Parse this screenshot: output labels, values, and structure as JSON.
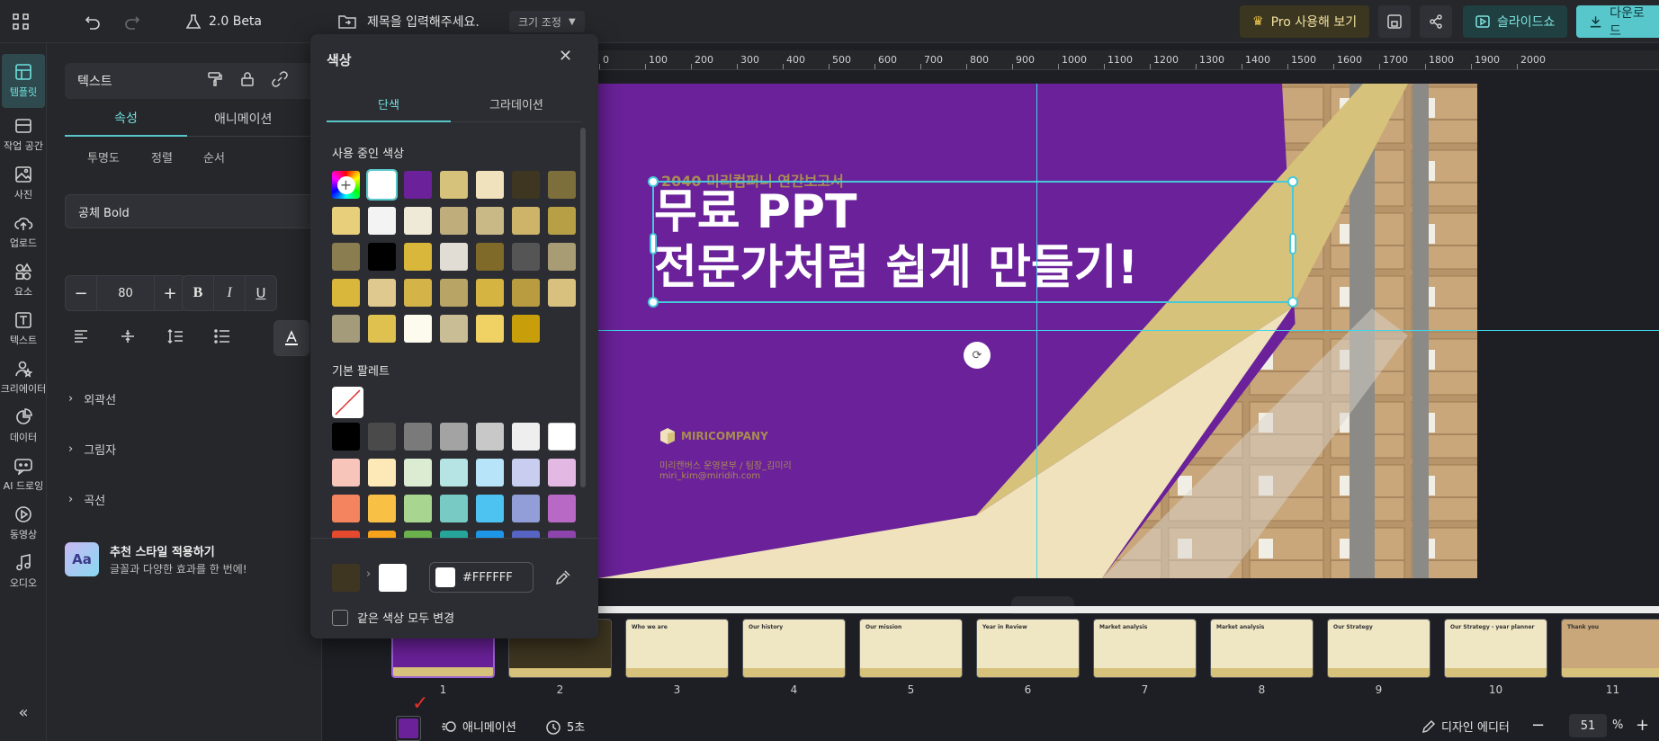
{
  "topbar": {
    "version": "2.0 Beta",
    "title_placeholder": "제목을 입력해주세요.",
    "resize_label": "크기 조정",
    "pro_label": "Pro 사용해 보기",
    "slideshow_label": "슬라이드쇼",
    "download_label": "다운로드"
  },
  "leftnav": [
    {
      "label": "템플릿"
    },
    {
      "label": "작업 공간"
    },
    {
      "label": "사진"
    },
    {
      "label": "업로드"
    },
    {
      "label": "요소"
    },
    {
      "label": "텍스트"
    },
    {
      "label": "크리에이터"
    },
    {
      "label": "데이터"
    },
    {
      "label": "AI 드로잉"
    },
    {
      "label": "동영상"
    },
    {
      "label": "오디오"
    }
  ],
  "panel": {
    "header": "텍스트",
    "tabs": [
      "속성",
      "애니메이션"
    ],
    "subtabs": [
      "투명도",
      "정렬",
      "순서"
    ],
    "font": "공체 Bold",
    "font_size": "80",
    "sections": [
      "외곽선",
      "그림자",
      "곡선"
    ],
    "promo_title": "추천 스타일 적용하기",
    "promo_desc": "글꼴과 다양한 효과를 한 번에!"
  },
  "colorpicker": {
    "title": "색상",
    "tabs": [
      "단색",
      "그라데이션"
    ],
    "used_title": "사용 중인 색상",
    "palette_title": "기본 팔레트",
    "hex": "#FFFFFF",
    "apply_all_label": "같은 색상 모두 변경",
    "used_colors": [
      "#ffffff",
      "#6a2199",
      "#d6c27a",
      "#efe2bd",
      "#3e3620",
      "#7d6f3c",
      "#e8cf7b",
      "#f3f3f3",
      "#efe9d7",
      "#bfae7b",
      "#c9b987",
      "#cdb468",
      "#b79f45",
      "#8a7d50",
      "#000000",
      "#d8b73a",
      "#e1ddd4",
      "#7f6a2a",
      "#555555",
      "#a79c74",
      "#d9b73a",
      "#e0c98e",
      "#d4b449",
      "#b8a465",
      "#d5b441",
      "#b89c3f",
      "#d8c07e",
      "#a49b7a",
      "#dfc14f",
      "#fdfbee",
      "#c9bd95",
      "#f0d163",
      "#c89f0b"
    ],
    "palette_colors": [
      "#000000",
      "#4a4a4a",
      "#7a7a7a",
      "#a3a3a3",
      "#c8c8c8",
      "#eeeeee",
      "#ffffff",
      "#f8c5bb",
      "#fde9b7",
      "#dcecd2",
      "#b6e3e3",
      "#b7e4f8",
      "#c9cdf0",
      "#e3b9e3",
      "#f4845f",
      "#f9c046",
      "#a8d58f",
      "#78cbc4",
      "#4cc3f0",
      "#929ed8",
      "#b868c5",
      "#e5492e",
      "#f6a31b",
      "#6ab04c",
      "#26a69a",
      "#1e96e8",
      "#5764c4",
      "#8e44ad"
    ]
  },
  "ruler": [
    "0",
    "100",
    "200",
    "300",
    "400",
    "500",
    "600",
    "700",
    "800",
    "900",
    "1000",
    "1100",
    "1200",
    "1300",
    "1400",
    "1500",
    "1600",
    "1700",
    "1800",
    "1900",
    "2000"
  ],
  "slide": {
    "subtitle": "2040 미리컴퍼니 연간보고서",
    "title_line1": "무료 PPT",
    "title_line2": "전문가처럼 쉽게 만들기!",
    "company": "MIRICOMPANY",
    "dept": "미리캔버스 운영본부 / 팀장_김미리",
    "email": "miri_kim@miridih.com"
  },
  "thumbnails": [
    {
      "num": "1",
      "title": "",
      "theme": "purple"
    },
    {
      "num": "2",
      "title": "",
      "theme": "dark"
    },
    {
      "num": "3",
      "title": "Who we are",
      "theme": "cream"
    },
    {
      "num": "4",
      "title": "Our history",
      "theme": "cream"
    },
    {
      "num": "5",
      "title": "Our mission",
      "theme": "cream"
    },
    {
      "num": "6",
      "title": "Year in Review",
      "theme": "cream"
    },
    {
      "num": "7",
      "title": "Market analysis",
      "theme": "cream"
    },
    {
      "num": "8",
      "title": "Market analysis",
      "theme": "cream"
    },
    {
      "num": "9",
      "title": "Our Strategy",
      "theme": "cream"
    },
    {
      "num": "10",
      "title": "Our Strategy - year planner",
      "theme": "cream"
    },
    {
      "num": "11",
      "title": "Thank you",
      "theme": "photo"
    }
  ],
  "bottombar": {
    "animation_label": "애니메이션",
    "duration_label": "5초",
    "design_editor_label": "디자인 에디터",
    "zoom": "51",
    "zoom_unit": "%",
    "swatch_color": "#6a2199"
  },
  "accent": "#58c7cc",
  "brand_purple": "#6a2199"
}
